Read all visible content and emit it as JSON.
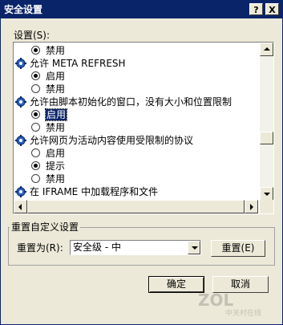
{
  "window": {
    "title": "安全设置",
    "help_glyph": "?",
    "close_glyph": "X"
  },
  "settings_label": "设置(S):",
  "tree": {
    "rows": [
      {
        "type": "option",
        "label": "禁用",
        "selected": true
      },
      {
        "type": "header",
        "label": "允许 META REFRESH",
        "icon": "settings-gear-icon"
      },
      {
        "type": "option",
        "label": "启用",
        "selected": true
      },
      {
        "type": "option",
        "label": "禁用",
        "selected": false
      },
      {
        "type": "header",
        "label": "允许由脚本初始化的窗口，没有大小和位置限制",
        "icon": "settings-gear-icon"
      },
      {
        "type": "option",
        "label": "启用",
        "selected": true,
        "focused": true
      },
      {
        "type": "option",
        "label": "禁用",
        "selected": false
      },
      {
        "type": "header",
        "label": "允许网页为活动内容使用受限制的协议",
        "icon": "settings-gear-icon"
      },
      {
        "type": "option",
        "label": "启用",
        "selected": false
      },
      {
        "type": "option",
        "label": "提示",
        "selected": true
      },
      {
        "type": "option",
        "label": "禁用",
        "selected": false
      },
      {
        "type": "header",
        "label": "在 IFRAME 中加载程序和文件",
        "icon": "settings-gear-icon"
      },
      {
        "type": "option",
        "label": "启用",
        "selected": false
      }
    ]
  },
  "reset": {
    "group_label": "重置自定义设置",
    "reset_to_label": "重置为(R):",
    "level_value": "安全级 - 中",
    "reset_button": "重置(E)"
  },
  "buttons": {
    "ok": "确定",
    "cancel": "取消"
  },
  "watermark": {
    "logo": "ZOL",
    "sub": "中关村在线"
  },
  "colors": {
    "titlebar": "#0a246a",
    "dialog_bg": "#ece9d8",
    "selection": "#0a246a"
  }
}
